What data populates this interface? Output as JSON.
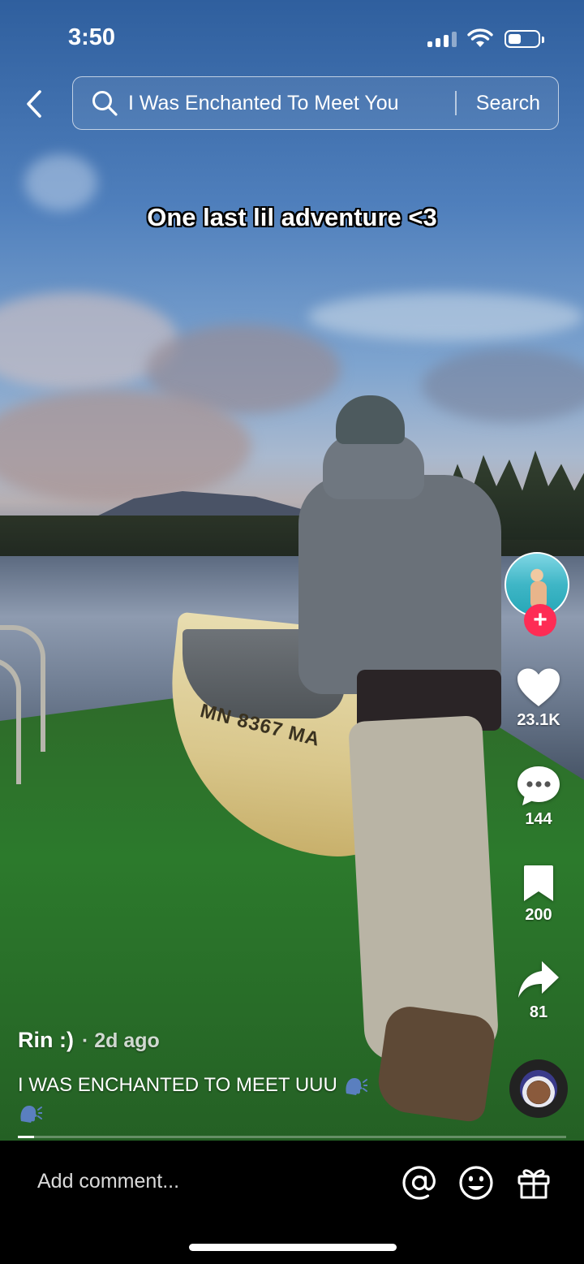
{
  "status_bar": {
    "time": "3:50",
    "signal_icon": "cellular-signal-icon",
    "wifi_icon": "wifi-icon",
    "battery_icon": "battery-icon",
    "battery_level": 0.45
  },
  "header": {
    "back_icon": "chevron-left-icon",
    "search_icon": "search-icon",
    "search_query": "I Was Enchanted To Meet You",
    "search_button": "Search"
  },
  "video": {
    "caption_overlay": "One last lil adventure <3",
    "boat_registration": "MN 8367 MA",
    "progress": 0.01
  },
  "creator": {
    "avatar_icon": "creator-avatar",
    "follow_label": "+"
  },
  "actions": {
    "like": {
      "icon": "heart-icon",
      "count": "23.1K"
    },
    "comment": {
      "icon": "comment-bubble-icon",
      "count": "144"
    },
    "save": {
      "icon": "bookmark-icon",
      "count": "200"
    },
    "share": {
      "icon": "share-arrow-icon",
      "count": "81"
    },
    "sound": {
      "icon": "sound-disc-avatar"
    }
  },
  "post": {
    "author": "Rin :)",
    "posted": "· 2d ago",
    "description": "I WAS ENCHANTED TO MEET UUU",
    "emoji_icon": "speaking-head-emoji"
  },
  "comment_bar": {
    "placeholder": "Add comment...",
    "mention_icon": "at-sign-icon",
    "emoji_icon": "emoji-face-icon",
    "gift_icon": "gift-icon"
  },
  "colors": {
    "follow_accent": "#fe2c55",
    "bottom_bar": "#000000"
  }
}
